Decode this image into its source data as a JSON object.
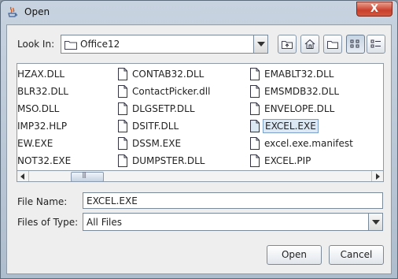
{
  "window": {
    "title": "Open",
    "close_label": "X"
  },
  "look_in": {
    "label": "Look In:",
    "folder": "Office12"
  },
  "toolbar": {
    "up_folder": "up-one-level",
    "home": "home",
    "new_folder": "create-new-folder",
    "list_view": "list",
    "details_view": "details"
  },
  "files": {
    "col1": [
      "HZAX.DLL",
      "BLR32.DLL",
      "MSO.DLL",
      "IMP32.HLP",
      "EW.EXE",
      "NOT32.EXE"
    ],
    "col2": [
      "CONTAB32.DLL",
      "ContactPicker.dll",
      "DLGSETP.DLL",
      "DSITF.DLL",
      "DSSM.EXE",
      "DUMPSTER.DLL"
    ],
    "col3": [
      "EMABLT32.DLL",
      "EMSMDB32.DLL",
      "ENVELOPE.DLL",
      "EXCEL.EXE",
      "excel.exe.manifest",
      "EXCEL.PIP"
    ],
    "selected": "EXCEL.EXE"
  },
  "file_name": {
    "label": "File Name:",
    "value": "EXCEL.EXE"
  },
  "file_type": {
    "label": "Files of Type:",
    "value": "All Files"
  },
  "buttons": {
    "open": "Open",
    "cancel": "Cancel"
  },
  "colors": {
    "selection_bg": "#dde8f5",
    "selection_border": "#7ca0c8",
    "title_bg": "#c8d3e0",
    "close_red": "#c9402b"
  }
}
